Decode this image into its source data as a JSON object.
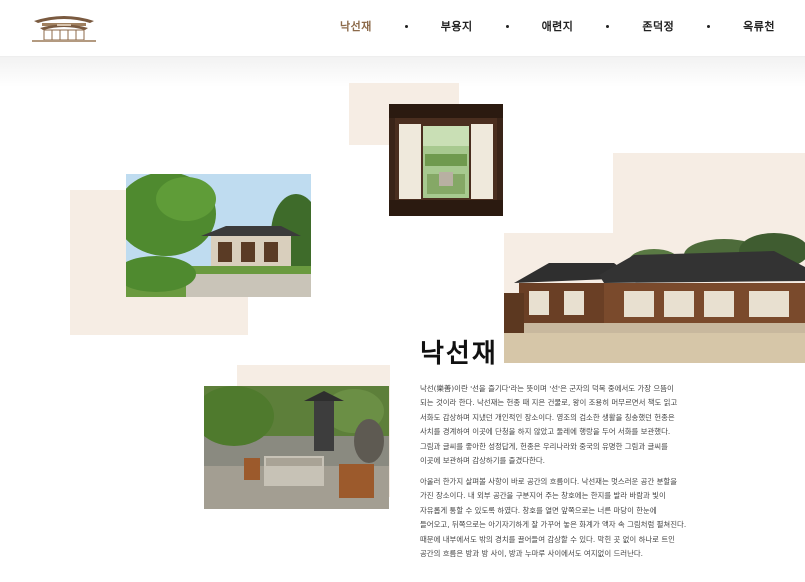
{
  "nav": {
    "items": [
      {
        "label": "낙선재",
        "active": true
      },
      {
        "label": "부용지",
        "active": false
      },
      {
        "label": "애련지",
        "active": false
      },
      {
        "label": "존덕정",
        "active": false
      },
      {
        "label": "옥류천",
        "active": false
      }
    ],
    "separator": "·"
  },
  "colors": {
    "accent": "#8c6a4a",
    "beige": "#f6ede4",
    "text": "#444444"
  },
  "content": {
    "title": "낙선재",
    "paragraph1": "낙선(樂善)이란 '선을 즐기다'라는 뜻이며 '선'은 군자의 덕목 중에서도 가장 으뜸이 되는 것이라 한다. 낙선재는 헌종 때 지은 건물로, 왕이 조용히 머무르면서 책도 읽고 서화도 감상하며 지냈던 개인적인 장소이다. 영조의 검소한 생활을 칭송했던 헌종은 사치를 경계하여 이곳에 단청을 하지 않았고 둘레에 행랑을 두어 서화를 보관했다. 그림과 글씨를 좋아한 성정답게, 헌종은 우리나라와 중국의 유명한 그림과 글씨를 이곳에 보관하며 감상하기를 즐겼다한다.",
    "paragraph2": "아울러 한가지 살펴볼 사항이 바로 공간의 흐름이다. 낙선재는 멋스러운 공간 분할을 가진 장소이다. 내 외부 공간을 구분지어 주는 창호에는 한지를 발라 바람과 빛이 자유롭게 통할 수 있도록 하였다. 창호를 열면 앞쪽으로는 너른 마당이 한눈에 들어오고, 뒤쪽으로는 아기자기하게 잘 가꾸어 놓은 화계가 액자 속 그림처럼 펼쳐진다. 때문에 내부에서도 밖의 경치를 끌어들여 감상할 수 있다. 막힌 곳 없이 하나로 트인 공간의 흐름은 방과 방 사이, 방과 누마루 사이에서도 여지없이 드러난다."
  }
}
